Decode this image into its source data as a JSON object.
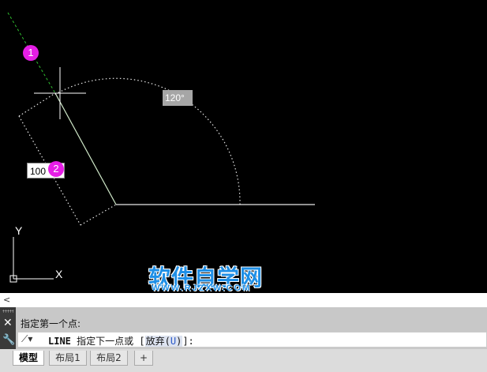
{
  "canvas": {
    "angle_label": "120°",
    "length_value": "100",
    "badge_1": "1",
    "badge_2": "2",
    "ucs_y": "Y",
    "ucs_x": "X"
  },
  "watermark": {
    "title": "软件自学网",
    "url": "WWW.RJZXW.COM"
  },
  "command_line": {
    "history_toggle": "<",
    "history_text": "指定第一个点:",
    "command_name": "LINE",
    "prompt": "指定下一点或",
    "option_label": "放弃",
    "option_key": "U",
    "input_value": ""
  },
  "layout_tabs": [
    {
      "label": "模型",
      "active": true
    },
    {
      "label": "布局1",
      "active": false
    },
    {
      "label": "布局2",
      "active": false
    },
    {
      "label": "+",
      "active": false
    }
  ]
}
